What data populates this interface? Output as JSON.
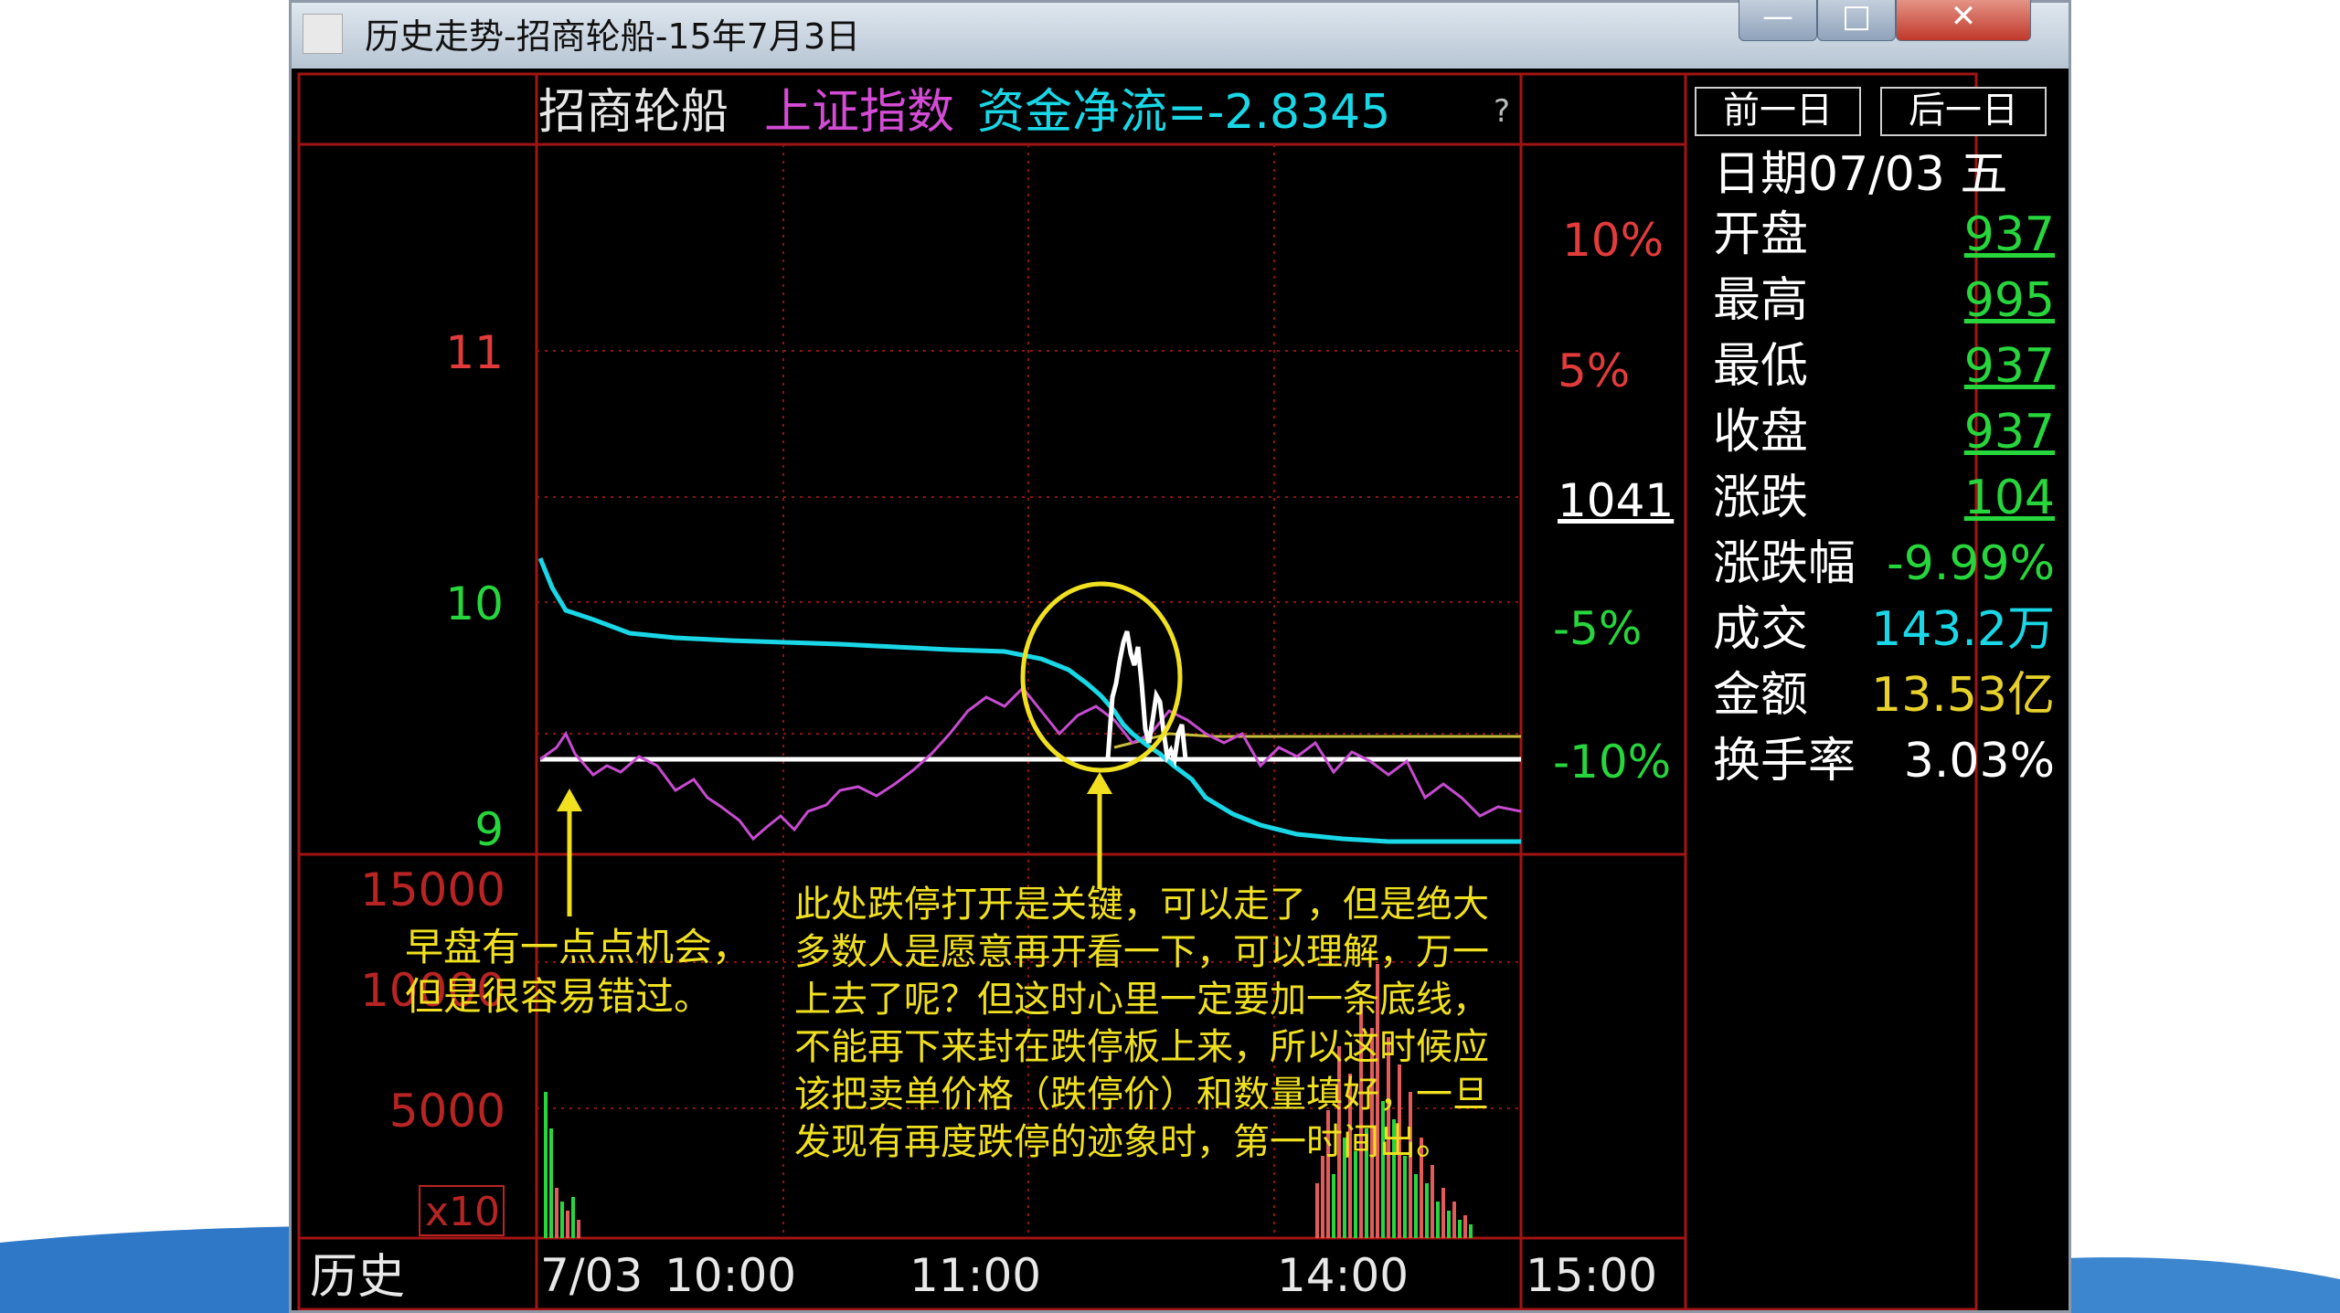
{
  "window": {
    "title": "历史走势-招商轮船-15年7月3日",
    "controls": {
      "minimize": "—",
      "maximize": "□",
      "close": "✕"
    }
  },
  "chart_header": {
    "stock": "招商轮船",
    "index": "上证指数",
    "flow": "资金净流=-2.8345",
    "help": "?"
  },
  "buttons": {
    "prev_day": "前一日",
    "next_day": "后一日"
  },
  "price_axis": {
    "ticks": [
      "11",
      "10",
      "9"
    ]
  },
  "percent_axis": {
    "ticks": [
      "10%",
      "5%",
      "1041",
      "-5%",
      "-10%"
    ]
  },
  "volume_axis": {
    "ticks": [
      "15000",
      "10000",
      "5000"
    ],
    "multiplier": "x10"
  },
  "time_axis": {
    "mode": "历史",
    "labels": [
      "7/03",
      "10:00",
      "11:00",
      "14:00",
      "15:00"
    ]
  },
  "annotations": {
    "left": [
      "早盘有一点点机会，",
      "但是很容易错过。"
    ],
    "right": [
      "此处跌停打开是关键，可以走了，但是绝大",
      "多数人是愿意再开看一下，可以理解，万一",
      "上去了呢？但这时心里一定要加一条底线，",
      "不能再下来封在跌停板上来，所以这时候应",
      "该把卖单价格（跌停价）和数量填好，一旦",
      "发现有再度跌停的迹象时，第一时间出。"
    ]
  },
  "side_panel": {
    "date": "日期07/03 五",
    "rows": [
      {
        "label": "开盘",
        "value": "937",
        "color": "green",
        "underline": true
      },
      {
        "label": "最高",
        "value": "995",
        "color": "green",
        "underline": true
      },
      {
        "label": "最低",
        "value": "937",
        "color": "green",
        "underline": true
      },
      {
        "label": "收盘",
        "value": "937",
        "color": "green",
        "underline": true
      },
      {
        "label": "涨跌",
        "value": "104",
        "color": "green",
        "underline": true
      },
      {
        "label": "涨跌幅",
        "value": "-9.99%",
        "color": "green",
        "underline": false
      },
      {
        "label": "成交",
        "value": "143.2万",
        "color": "cyan",
        "underline": false
      },
      {
        "label": "金额",
        "value": "13.53亿",
        "color": "yellow",
        "underline": false
      },
      {
        "label": "换手率",
        "value": "3.03%",
        "color": "white",
        "underline": false
      }
    ]
  },
  "colors": {
    "grid": "#a31414",
    "price_line": "#19d7e6",
    "index_line": "#c74bd0",
    "avg_line": "#c9bd3b",
    "limit_line": "#ffffff",
    "annotation": "#f0e020",
    "up_text": "#e23b3b",
    "down_text": "#27d63c"
  }
}
